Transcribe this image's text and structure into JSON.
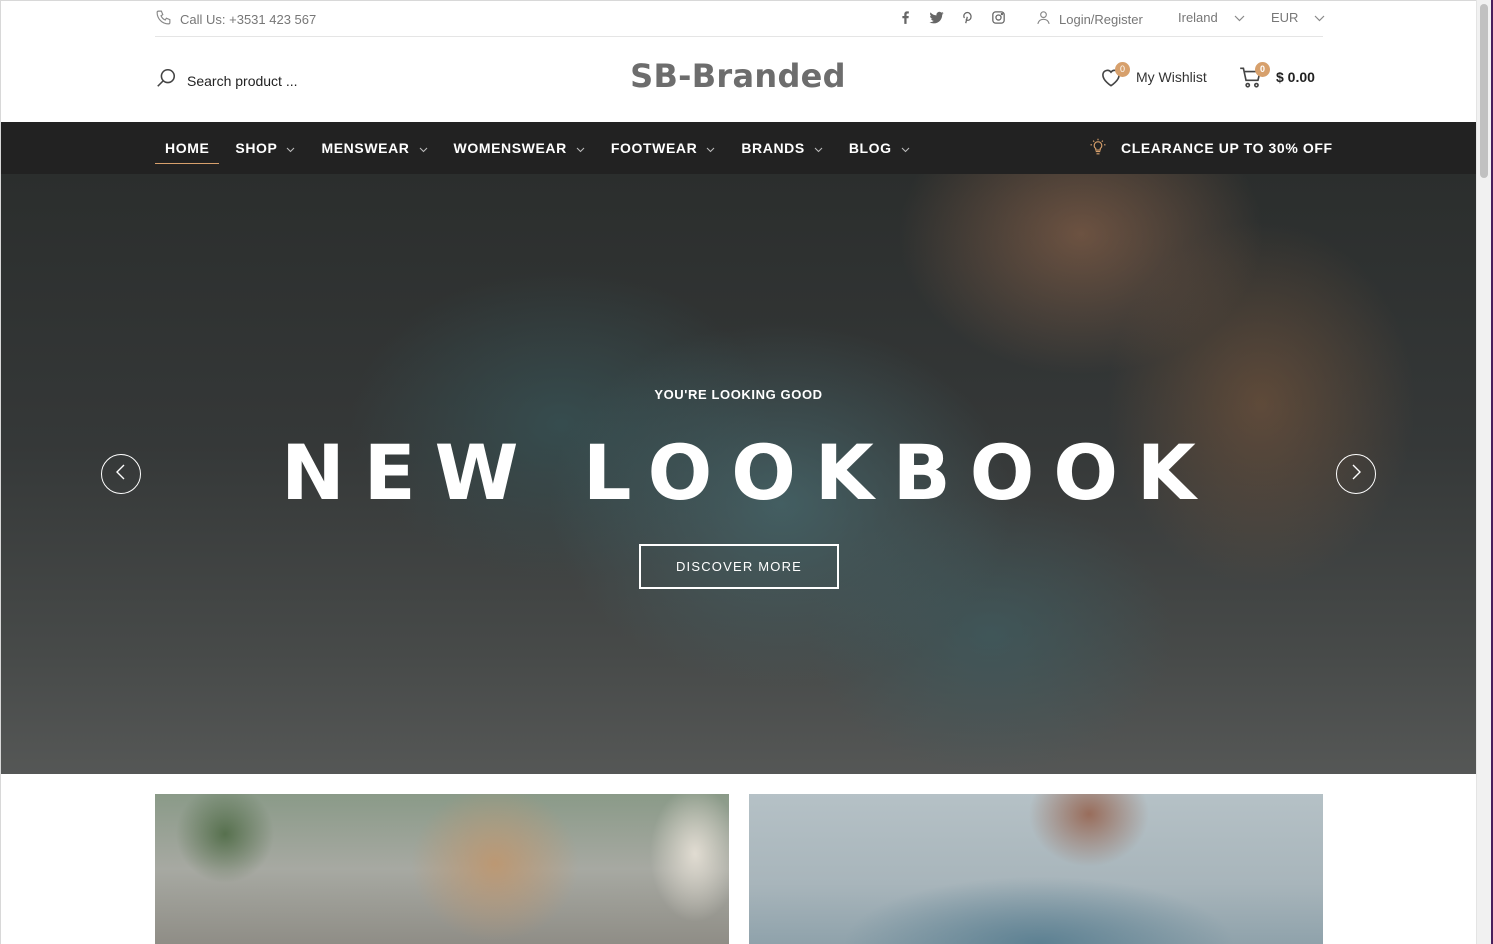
{
  "topbar": {
    "phone": "Call Us: +3531 423 567",
    "socials": [
      "facebook-icon",
      "twitter-icon",
      "pinterest-icon",
      "instagram-icon"
    ],
    "login": "Login/Register",
    "country": "Ireland",
    "currency": "EUR"
  },
  "header": {
    "search_placeholder": "Search product ...",
    "logo": "SB-Branded",
    "wishlist_label": "My Wishlist",
    "wishlist_count": "0",
    "cart_count": "0",
    "cart_total": "$ 0.00"
  },
  "nav": {
    "items": [
      {
        "label": "HOME",
        "active": true
      },
      {
        "label": "SHOP"
      },
      {
        "label": "MENSWEAR"
      },
      {
        "label": "WOMENSWEAR"
      },
      {
        "label": "FOOTWEAR"
      },
      {
        "label": "BRANDS"
      },
      {
        "label": "BLOG"
      }
    ],
    "promo": "CLEARANCE UP TO 30% OFF"
  },
  "hero": {
    "subtitle": "YOU'RE LOOKING GOOD",
    "title": "NEW LOOKBOOK",
    "button": "DISCOVER MORE"
  },
  "colors": {
    "accent": "#d7a06c",
    "navbar": "#222222"
  }
}
